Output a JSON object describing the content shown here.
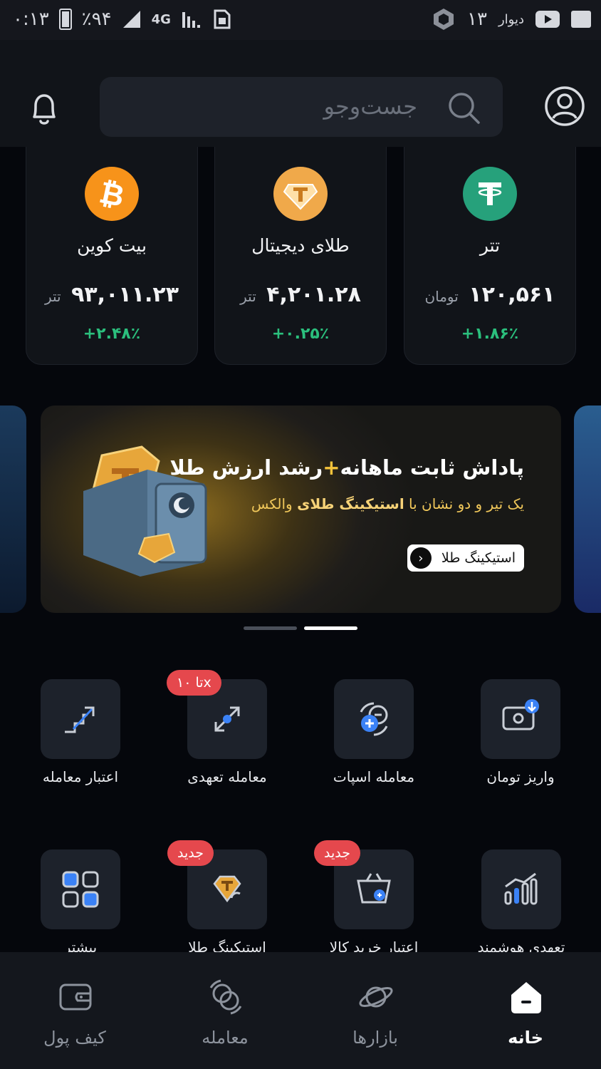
{
  "status_bar": {
    "time": "۰:۱۳",
    "battery": "٪۹۴",
    "network": "4G",
    "date_num": "۱۳",
    "app_name": "دیوار"
  },
  "header": {
    "search_placeholder": "جست‌وجو"
  },
  "coins": [
    {
      "name": "تتر",
      "price": "۱۲۰,۵۶۱",
      "unit": "تومان",
      "change": "+۱.۸۶٪",
      "color": "#26a17b",
      "icon": "tether-icon"
    },
    {
      "name": "طلای دیجیتال",
      "price": "۴,۲۰۱.۲۸",
      "unit": "تتر",
      "change": "+۰.۲۵٪",
      "color": "#f0a94a",
      "icon": "gold-token-icon"
    },
    {
      "name": "بیت کوین",
      "price": "۹۳,۰۱۱.۲۳",
      "unit": "تتر",
      "change": "+۲.۴۸٪",
      "color": "#f7931a",
      "icon": "bitcoin-icon"
    }
  ],
  "banner": {
    "title_part1": "پاداش ثابت ماهانه",
    "title_plus": "+",
    "title_part2": "رشد ارزش طلا",
    "subtitle_part1": "یک تیر و دو نشان با",
    "subtitle_bold": "استیکینگ طلای",
    "subtitle_part2": "والکس",
    "button_label": "استیکینگ طلا"
  },
  "actions": [
    {
      "label": "واریز تومان",
      "icon": "deposit-toman-icon"
    },
    {
      "label": "معامله اسپات",
      "icon": "spot-trade-icon"
    },
    {
      "label": "معامله تعهدی",
      "icon": "margin-trade-icon",
      "badge": "تا ۱۰x"
    },
    {
      "label": "اعتبار معامله",
      "icon": "trade-credit-icon"
    },
    {
      "label": "تعهدی هوشمند",
      "icon": "smart-margin-icon"
    },
    {
      "label": "اعتبار خرید کالا",
      "icon": "goods-credit-icon",
      "badge": "جدید"
    },
    {
      "label": "استیکینگ طلا",
      "icon": "gold-staking-icon",
      "badge": "جدید"
    },
    {
      "label": "بیشتر",
      "icon": "more-grid-icon"
    }
  ],
  "bottom_nav": [
    {
      "label": "خانه",
      "icon": "home-icon",
      "active": true
    },
    {
      "label": "بازارها",
      "icon": "markets-planet-icon",
      "active": false
    },
    {
      "label": "معامله",
      "icon": "trade-exchange-icon",
      "active": false
    },
    {
      "label": "کیف پول",
      "icon": "wallet-icon",
      "active": false
    }
  ]
}
